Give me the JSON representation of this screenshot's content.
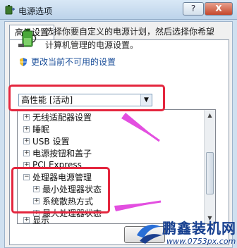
{
  "window": {
    "title": "电源选项",
    "help_label": "?",
    "close_label": "X"
  },
  "tab": {
    "label": "高级设置"
  },
  "description": "选择你要自定义的电源计划，然后选择你希望计算机管理的电源设置。",
  "change_settings_link": "更改当前不可用的设置",
  "plan_select": {
    "value": "高性能 [活动]"
  },
  "tree_items": [
    {
      "label": "无线适配器设置",
      "expander": "+"
    },
    {
      "label": "睡眠",
      "expander": "+"
    },
    {
      "label": "USB 设置",
      "expander": "+"
    },
    {
      "label": "电源按钮和盖子",
      "expander": "+"
    },
    {
      "label": "PCI Express",
      "expander": "+"
    },
    {
      "label": "处理器电源管理",
      "expander": "−"
    },
    {
      "label": "最小处理器状态",
      "expander": "+"
    },
    {
      "label": "系统散热方式",
      "expander": "+"
    },
    {
      "label": "最大处理器状态",
      "expander": "+"
    },
    {
      "label": "显示",
      "expander": "+"
    }
  ],
  "watermark": {
    "name": "鹏鑫装机网",
    "url": "www.0753px.com"
  },
  "colors": {
    "highlight_red": "#e4263e",
    "arrow_magenta": "#e34fe0",
    "link_blue": "#1b4f9a"
  },
  "icons": [
    "power-options-icon",
    "battery-plug-icon",
    "uac-shield-icon",
    "chevron-down-icon"
  ]
}
